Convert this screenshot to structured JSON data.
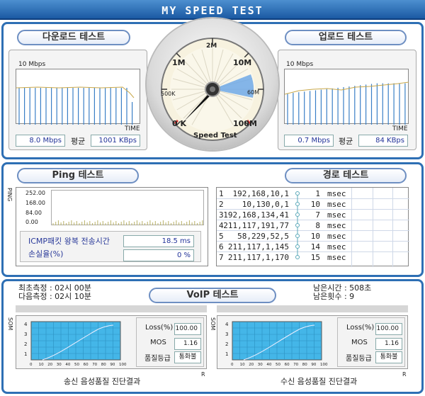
{
  "app": {
    "title": "MY SPEED TEST"
  },
  "download": {
    "title": "다운로드 테스트",
    "scale": "10 Mbps",
    "axis": "TIME",
    "speed": "8.0 Mbps",
    "avg_label": "평균",
    "avg": "1001 KBps"
  },
  "upload": {
    "title": "업로드 테스트",
    "scale": "10 Mbps",
    "axis": "TIME",
    "speed": "0.7 Mbps",
    "avg_label": "평균",
    "avg": "84 KBps"
  },
  "gauge": {
    "labels": {
      "top": "2M",
      "left_upper": "1M",
      "right_upper": "10M",
      "left_mid": "500K",
      "right_mid": "60M",
      "left_low": "0 K",
      "right_low": "100M"
    },
    "caption": "Speed Test"
  },
  "ping": {
    "title": "Ping 테스트",
    "axis": "PING",
    "yticks": [
      "252.00",
      "168.00",
      "84.00",
      "0.00"
    ],
    "icmp_label": "ICMP패킷 왕복 전송시간",
    "icmp_value": "18.5 ms",
    "loss_label": "손실율(%)",
    "loss_value": "0 %"
  },
  "route": {
    "title": "경로 테스트",
    "hops": [
      {
        "n": "1",
        "ip": "192,168,10,1",
        "ms": "1",
        "unit": "msec"
      },
      {
        "n": "2",
        "ip": "10,130,0,1",
        "ms": "10",
        "unit": "msec"
      },
      {
        "n": "3",
        "ip": "192,168,134,41",
        "ms": "7",
        "unit": "msec"
      },
      {
        "n": "4",
        "ip": "211,117,191,77",
        "ms": "8",
        "unit": "msec"
      },
      {
        "n": "5",
        "ip": "58,229,52,5",
        "ms": "10",
        "unit": "msec"
      },
      {
        "n": "6",
        "ip": "211,117,1,145",
        "ms": "14",
        "unit": "msec"
      },
      {
        "n": "7",
        "ip": "211,117,1,170",
        "ms": "15",
        "unit": "msec"
      }
    ]
  },
  "voip": {
    "title": "VoIP 테스트",
    "first": "최초측정 : 02시 00분",
    "next": "다음측정 : 02시 10분",
    "remain": "남은시간 : 508초",
    "remain_count": "남은횟수 : 9",
    "send": {
      "caption": "송신 음성품질 진단결과",
      "y_axis": "SOM",
      "x_axis": "R",
      "loss_label": "Loss(%)",
      "loss": "100.00",
      "mos_label": "MOS",
      "mos": "1.16",
      "grade_label": "품질등급",
      "grade": "통화불"
    },
    "recv": {
      "caption": "수신 음성품질 진단결과",
      "y_axis": "SOM",
      "x_axis": "R",
      "loss_label": "Loss(%)",
      "loss": "100.00",
      "mos_label": "MOS",
      "mos": "1.16",
      "grade_label": "품질등급",
      "grade": "통화불"
    },
    "yticks": [
      "4",
      "3",
      "2",
      "1"
    ],
    "xticks": [
      "0",
      "10",
      "20",
      "30",
      "40",
      "50",
      "60",
      "70",
      "80",
      "90",
      "100"
    ]
  }
}
